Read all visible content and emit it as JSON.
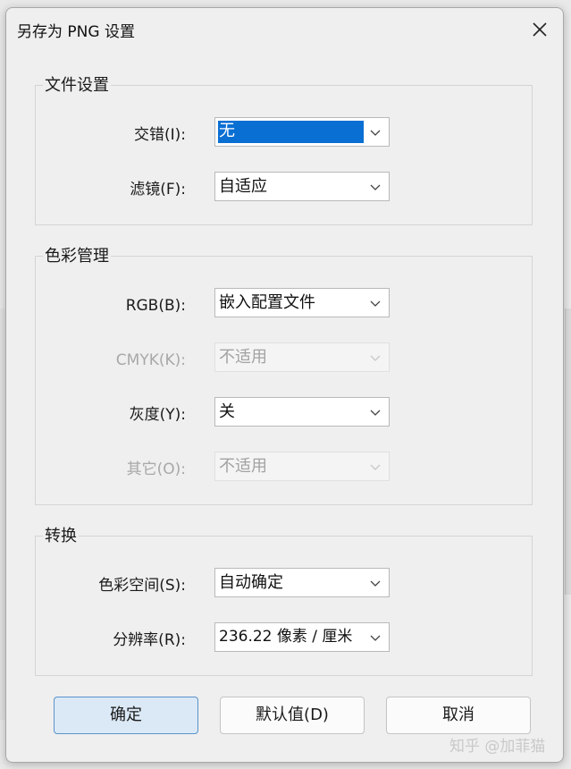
{
  "dialog": {
    "title": "另存为 PNG 设置"
  },
  "file_settings": {
    "title": "文件设置",
    "interlace": {
      "label": "交错(I):",
      "value": "无"
    },
    "filter": {
      "label": "滤镜(F):",
      "value": "自适应"
    }
  },
  "color_management": {
    "title": "色彩管理",
    "rgb": {
      "label": "RGB(B):",
      "value": "嵌入配置文件"
    },
    "cmyk": {
      "label": "CMYK(K):",
      "value": "不适用"
    },
    "gray": {
      "label": "灰度(Y):",
      "value": "关"
    },
    "other": {
      "label": "其它(O):",
      "value": "不适用"
    }
  },
  "conversion": {
    "title": "转换",
    "color_space": {
      "label": "色彩空间(S):",
      "value": "自动确定"
    },
    "resolution": {
      "label": "分辨率(R):",
      "value": "236.22 像素 / 厘米"
    }
  },
  "buttons": {
    "ok": "确定",
    "defaults": "默认值(D)",
    "cancel": "取消"
  },
  "watermark": "知乎 @加菲猫",
  "colors": {
    "accent": "#0a6fd3",
    "primary_button_bg": "#dbe9f6",
    "primary_button_border": "#5a93c9"
  },
  "icons": {
    "close": "close-icon",
    "dropdown": "chevron-down-icon"
  }
}
